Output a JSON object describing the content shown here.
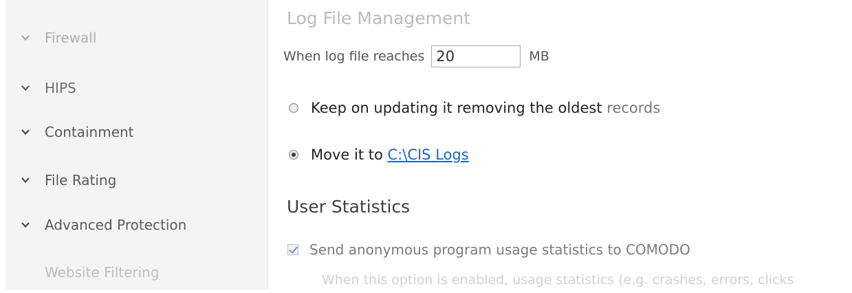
{
  "sidebar": {
    "items": [
      {
        "label": "Firewall",
        "icon": "chevron-down-icon"
      },
      {
        "label": "HIPS",
        "icon": "chevron-down-icon"
      },
      {
        "label": "Containment",
        "icon": "chevron-down-icon"
      },
      {
        "label": "File Rating",
        "icon": "chevron-down-icon"
      },
      {
        "label": "Advanced Protection",
        "icon": "chevron-down-icon"
      },
      {
        "label": "Website Filtering"
      }
    ]
  },
  "log_management": {
    "title": "Log File Management",
    "size_label": "When log file reaches",
    "size_value": "20",
    "size_unit": "MB",
    "option_keep": {
      "label_main": "Keep on updating it removing the oldest",
      "label_faded": "records",
      "selected": false
    },
    "option_move": {
      "label": "Move it to",
      "path": "C:\\CIS Logs",
      "selected": true
    }
  },
  "user_statistics": {
    "title": "User Statistics",
    "send_stats_label": "Send anonymous program usage statistics to COMODO",
    "send_stats_checked": true,
    "description": "When this option is enabled, usage statistics (e.g. crashes, errors, clicks"
  },
  "colors": {
    "link": "#1a66c4",
    "sidebar_bg": "#f4f4f4"
  }
}
